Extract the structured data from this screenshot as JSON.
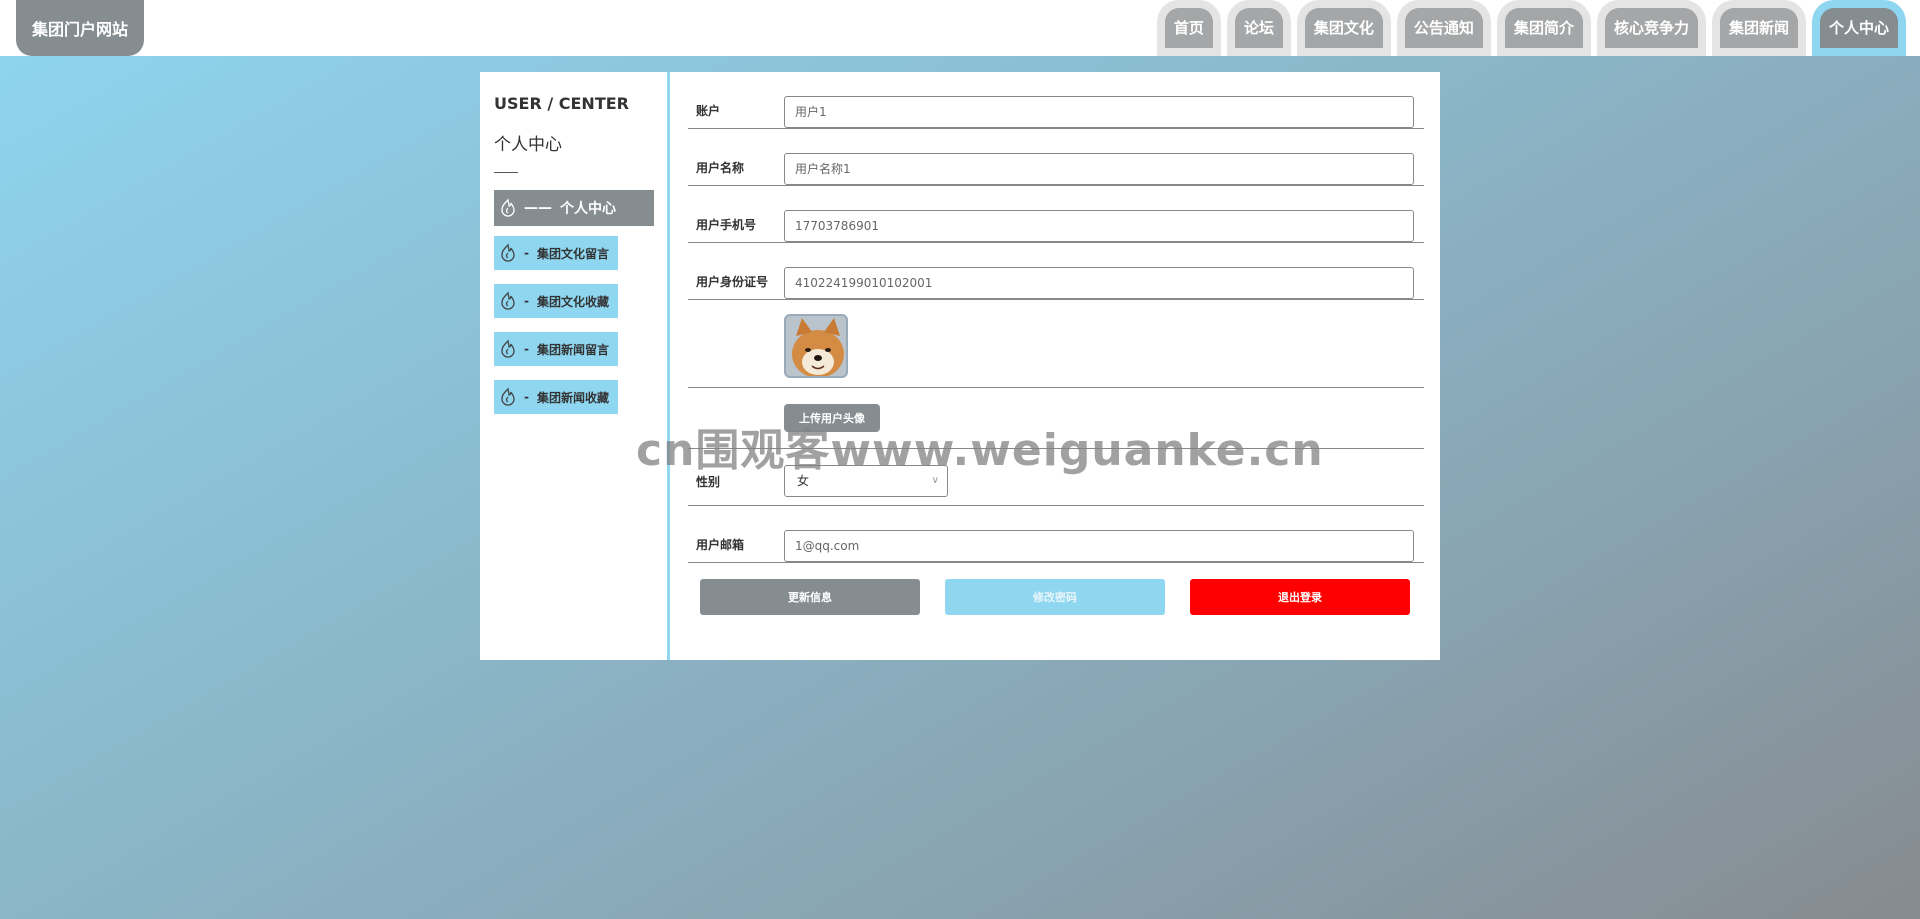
{
  "header": {
    "brand": "集团门户网站",
    "nav": [
      "首页",
      "论坛",
      "集团文化",
      "公告通知",
      "集团简介",
      "核心竞争力",
      "集团新闻",
      "个人中心"
    ],
    "active_index": 7
  },
  "sidebar": {
    "title_en": "USER / CENTER",
    "title_cn": "个人中心",
    "items": [
      {
        "label": "个人中心",
        "sep": "——"
      },
      {
        "label": "集团文化留言",
        "sep": "-"
      },
      {
        "label": "集团文化收藏",
        "sep": "-"
      },
      {
        "label": "集团新闻留言",
        "sep": "-"
      },
      {
        "label": "集团新闻收藏",
        "sep": "-"
      }
    ]
  },
  "form": {
    "account_label": "账户",
    "account_value": "用户1",
    "username_label": "用户名称",
    "username_value": "用户名称1",
    "phone_label": "用户手机号",
    "phone_value": "17703786901",
    "idcard_label": "用户身份证号",
    "idcard_value": "410224199010102001",
    "upload_label": "上传用户头像",
    "gender_label": "性别",
    "gender_value": "女",
    "email_label": "用户邮箱",
    "email_value": "1@qq.com"
  },
  "buttons": {
    "update": "更新信息",
    "change_password": "修改密码",
    "logout": "退出登录"
  },
  "watermark": "cn围观客www.weiguanke.cn",
  "colors": {
    "accent": "#8fd6f1",
    "gray": "#858d91",
    "danger": "#ff0000"
  }
}
